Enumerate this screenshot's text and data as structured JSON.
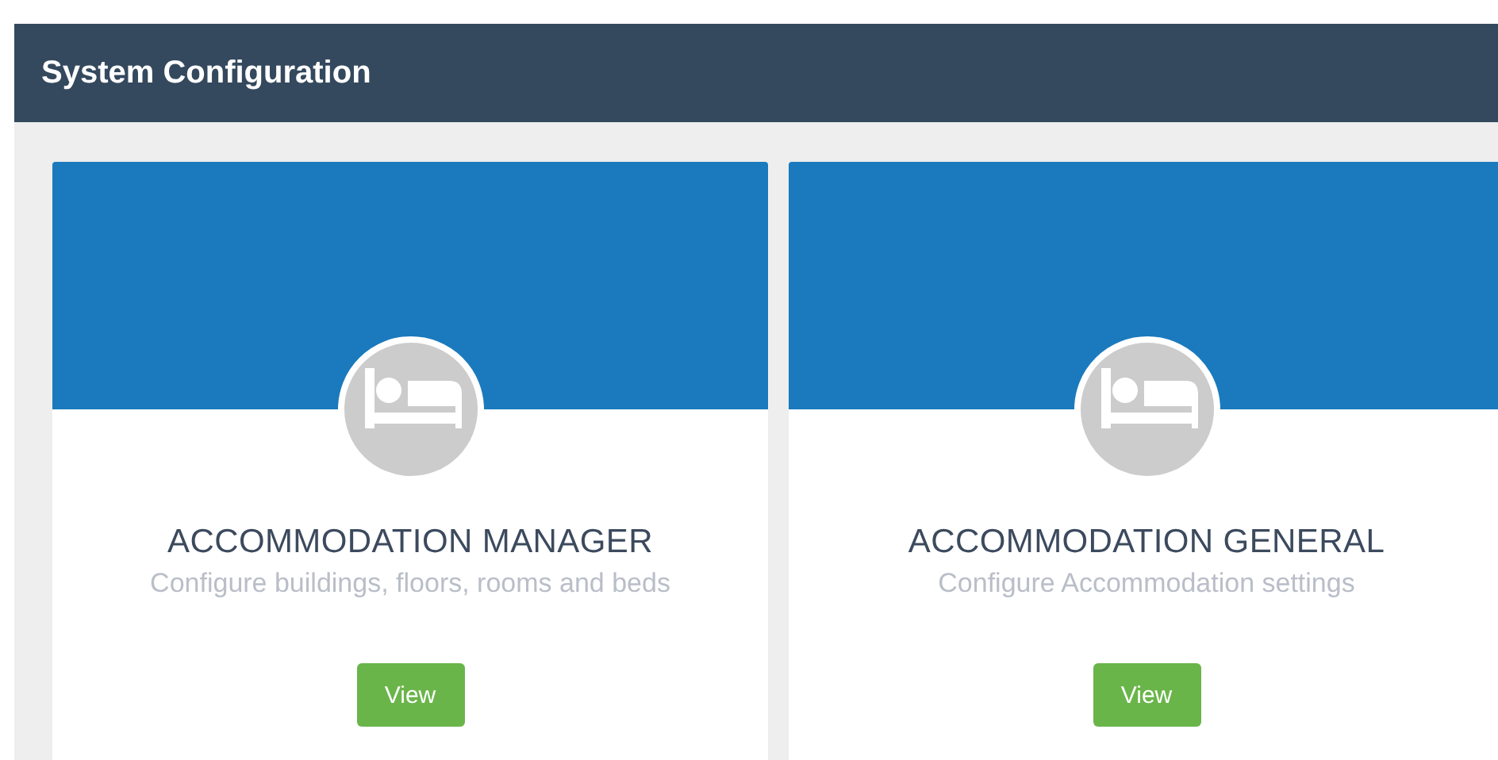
{
  "header": {
    "title": "System Configuration"
  },
  "cards": [
    {
      "title": "ACCOMMODATION MANAGER",
      "description": "Configure buildings, floors, rooms and beds",
      "button": "View"
    },
    {
      "title": "ACCOMMODATION GENERAL",
      "description": "Configure Accommodation settings",
      "button": "View"
    }
  ]
}
